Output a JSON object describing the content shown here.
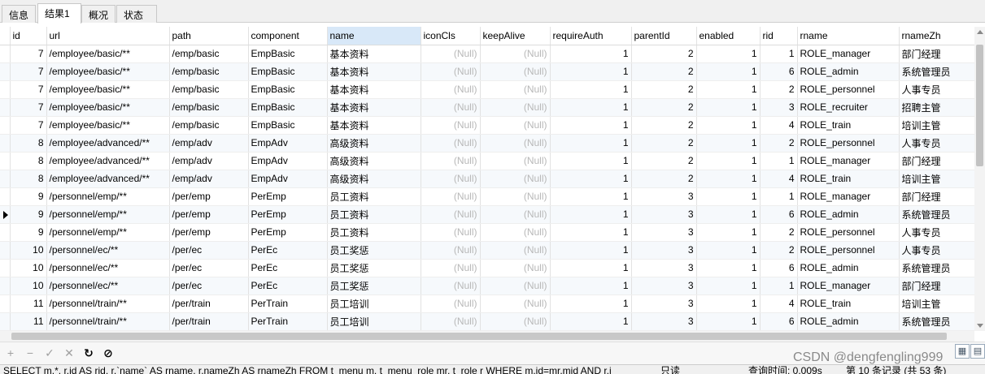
{
  "tabs": [
    "信息",
    "结果1",
    "概况",
    "状态"
  ],
  "columns": [
    "",
    "id",
    "url",
    "path",
    "component",
    "name",
    "iconCls",
    "keepAlive",
    "requireAuth",
    "parentId",
    "enabled",
    "rid",
    "rname",
    "rnameZh"
  ],
  "selected_column": "name",
  "null_text": "(Null)",
  "rows": [
    [
      "",
      "7",
      "/employee/basic/**",
      "/emp/basic",
      "EmpBasic",
      "基本资料",
      "(Null)",
      "(Null)",
      "1",
      "2",
      "1",
      "1",
      "ROLE_manager",
      "部门经理"
    ],
    [
      "",
      "7",
      "/employee/basic/**",
      "/emp/basic",
      "EmpBasic",
      "基本资料",
      "(Null)",
      "(Null)",
      "1",
      "2",
      "1",
      "6",
      "ROLE_admin",
      "系统管理员"
    ],
    [
      "",
      "7",
      "/employee/basic/**",
      "/emp/basic",
      "EmpBasic",
      "基本资料",
      "(Null)",
      "(Null)",
      "1",
      "2",
      "1",
      "2",
      "ROLE_personnel",
      "人事专员"
    ],
    [
      "",
      "7",
      "/employee/basic/**",
      "/emp/basic",
      "EmpBasic",
      "基本资料",
      "(Null)",
      "(Null)",
      "1",
      "2",
      "1",
      "3",
      "ROLE_recruiter",
      "招聘主管"
    ],
    [
      "",
      "7",
      "/employee/basic/**",
      "/emp/basic",
      "EmpBasic",
      "基本资料",
      "(Null)",
      "(Null)",
      "1",
      "2",
      "1",
      "4",
      "ROLE_train",
      "培训主管"
    ],
    [
      "",
      "8",
      "/employee/advanced/**",
      "/emp/adv",
      "EmpAdv",
      "高级资料",
      "(Null)",
      "(Null)",
      "1",
      "2",
      "1",
      "2",
      "ROLE_personnel",
      "人事专员"
    ],
    [
      "",
      "8",
      "/employee/advanced/**",
      "/emp/adv",
      "EmpAdv",
      "高级资料",
      "(Null)",
      "(Null)",
      "1",
      "2",
      "1",
      "1",
      "ROLE_manager",
      "部门经理"
    ],
    [
      "",
      "8",
      "/employee/advanced/**",
      "/emp/adv",
      "EmpAdv",
      "高级资料",
      "(Null)",
      "(Null)",
      "1",
      "2",
      "1",
      "4",
      "ROLE_train",
      "培训主管"
    ],
    [
      "",
      "9",
      "/personnel/emp/**",
      "/per/emp",
      "PerEmp",
      "员工资料",
      "(Null)",
      "(Null)",
      "1",
      "3",
      "1",
      "1",
      "ROLE_manager",
      "部门经理"
    ],
    [
      "▶",
      "9",
      "/personnel/emp/**",
      "/per/emp",
      "PerEmp",
      "员工资料",
      "(Null)",
      "(Null)",
      "1",
      "3",
      "1",
      "6",
      "ROLE_admin",
      "系统管理员"
    ],
    [
      "",
      "9",
      "/personnel/emp/**",
      "/per/emp",
      "PerEmp",
      "员工资料",
      "(Null)",
      "(Null)",
      "1",
      "3",
      "1",
      "2",
      "ROLE_personnel",
      "人事专员"
    ],
    [
      "",
      "10",
      "/personnel/ec/**",
      "/per/ec",
      "PerEc",
      "员工奖惩",
      "(Null)",
      "(Null)",
      "1",
      "3",
      "1",
      "2",
      "ROLE_personnel",
      "人事专员"
    ],
    [
      "",
      "10",
      "/personnel/ec/**",
      "/per/ec",
      "PerEc",
      "员工奖惩",
      "(Null)",
      "(Null)",
      "1",
      "3",
      "1",
      "6",
      "ROLE_admin",
      "系统管理员"
    ],
    [
      "",
      "10",
      "/personnel/ec/**",
      "/per/ec",
      "PerEc",
      "员工奖惩",
      "(Null)",
      "(Null)",
      "1",
      "3",
      "1",
      "1",
      "ROLE_manager",
      "部门经理"
    ],
    [
      "",
      "11",
      "/personnel/train/**",
      "/per/train",
      "PerTrain",
      "员工培训",
      "(Null)",
      "(Null)",
      "1",
      "3",
      "1",
      "4",
      "ROLE_train",
      "培训主管"
    ],
    [
      "",
      "11",
      "/personnel/train/**",
      "/per/train",
      "PerTrain",
      "员工培训",
      "(Null)",
      "(Null)",
      "1",
      "3",
      "1",
      "6",
      "ROLE_admin",
      "系统管理员"
    ]
  ],
  "toolbar": {
    "add": "+",
    "delete": "−",
    "apply": "✓",
    "cancel": "✕",
    "refresh": "↻",
    "stop": "⊘"
  },
  "watermark": "CSDN @dengfengling999",
  "status": {
    "sql": "SELECT m.*, r.id AS rid, r.`name` AS rname, r.nameZh AS rnameZh FROM t_menu m, t_menu_role mr, t_role r WHERE m.id=mr.mid AND r.i",
    "mode": "只读",
    "query_time": "查询时间: 0.009s",
    "record": "第 10 条记录 (共 53 条)"
  }
}
